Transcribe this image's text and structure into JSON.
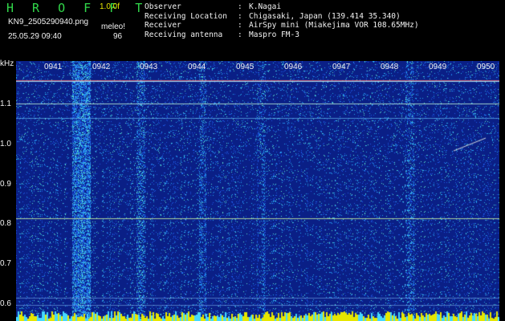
{
  "header": {
    "title": "H R O F F T",
    "version": "1.0.0f",
    "filename": "KN9_2505290940.png",
    "meleo": "meleo!",
    "datetime": "25.05.29 09:40",
    "count": "96"
  },
  "info": [
    {
      "key": "Observer",
      "value": "K.Nagai"
    },
    {
      "key": "Receiving Location",
      "value": "Chigasaki, Japan (139.414 35.340)"
    },
    {
      "key": "Receiver",
      "value": "AirSpy mini (Miakejima VOR 108.65MHz)"
    },
    {
      "key": "Receiving antenna",
      "value": "Maspro FM-3"
    }
  ],
  "axis": {
    "unit": "kHz",
    "y_ticks": [
      "1.1",
      "1.0",
      "0.9",
      "0.8",
      "0.7",
      "0.6"
    ],
    "time_ticks": [
      "0941",
      "0942",
      "0943",
      "0944",
      "0945",
      "0946",
      "0947",
      "0948",
      "0949",
      "0950"
    ]
  },
  "colors": {
    "background": "#0a1f86",
    "header_text": "#f2f2f2",
    "title": "#31d84a",
    "version": "#e8e800"
  }
}
